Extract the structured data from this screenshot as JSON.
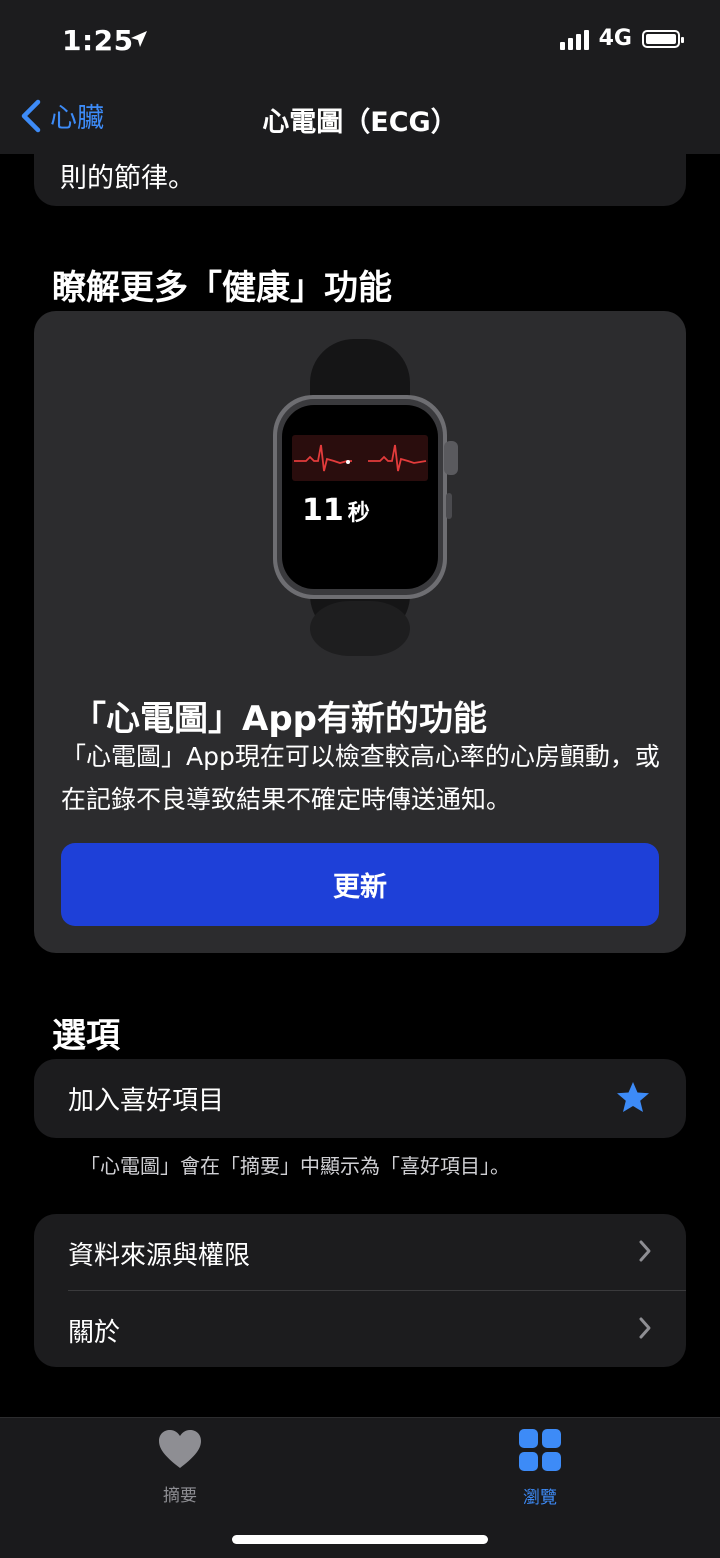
{
  "status_bar": {
    "time": "1:25",
    "network": "4G"
  },
  "nav": {
    "back_label": "心臟",
    "title": "心電圖（ECG）"
  },
  "top_card": {
    "text": "則的節律。"
  },
  "learn_more": {
    "heading": "瞭解更多「健康」功能",
    "watch": {
      "timer_value": "11",
      "timer_unit": "秒"
    },
    "title": "「心電圖」App有新的功能",
    "description": "「心電圖」App現在可以檢查較高心率的心房顫動，或在記錄不良導致結果不確定時傳送通知。",
    "button_label": "更新"
  },
  "options": {
    "heading": "選項",
    "favorite_label": "加入喜好項目",
    "favorite_note": "「心電圖」會在「摘要」中顯示為「喜好項目」。",
    "items": [
      {
        "label": "資料來源與權限"
      },
      {
        "label": "關於"
      }
    ]
  },
  "tabbar": {
    "tabs": [
      {
        "label": "摘要",
        "icon": "heart-icon"
      },
      {
        "label": "瀏覽",
        "icon": "grid-icon"
      }
    ],
    "active_color": "#3d8bf7",
    "inactive_color": "#8e8e93"
  },
  "colors": {
    "accent": "#3d8bf7",
    "button": "#1e40d8",
    "ecg_line": "#e23b3b"
  }
}
